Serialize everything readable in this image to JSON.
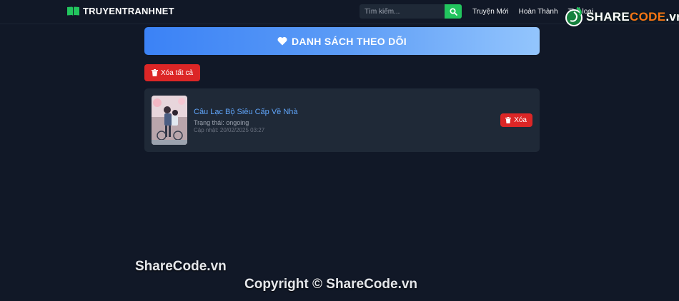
{
  "navbar": {
    "brand": "TRUYENTRANHNET",
    "search_placeholder": "Tìm kiếm...",
    "links": [
      "Truyện Mới",
      "Hoàn Thành",
      "Thể loại"
    ]
  },
  "overlay_logo": {
    "text_main": "SHARE",
    "text_accent": "CODE",
    "text_suffix": ".vn"
  },
  "page": {
    "title": "DANH SÁCH THEO DÕI",
    "clear_all_label": "Xóa tất cả"
  },
  "follow_list": [
    {
      "title": "Câu Lạc Bộ Siêu Cấp Về Nhà",
      "status": "Trạng thái: ongoing",
      "updated": "Cập nhật: 20/02/2025 03:27",
      "delete_label": "Xóa"
    }
  ],
  "watermarks": {
    "line1": "ShareCode.vn",
    "line2": "Copyright © ShareCode.vn"
  },
  "colors": {
    "background": "#111827",
    "card": "#1f2937",
    "accent_blue": "#3b82f6",
    "danger": "#dc2626",
    "search_button": "#22c55e",
    "link": "#60a5fa"
  },
  "icons": {
    "brand": "book-open-icon",
    "search": "search-icon",
    "banner": "heart-icon",
    "delete": "trash-icon"
  }
}
